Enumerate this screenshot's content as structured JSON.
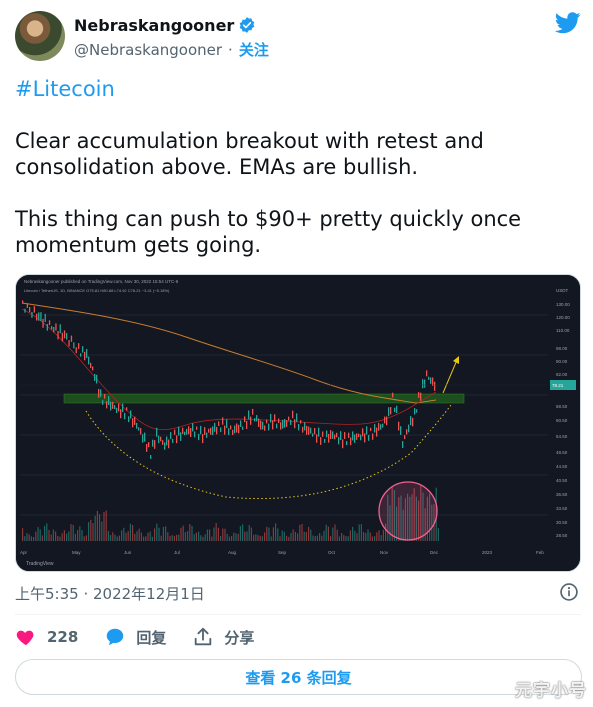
{
  "author": {
    "display_name": "Nebraskangooner",
    "handle": "@Nebraskangooner",
    "separator": "·",
    "follow_label": "关注",
    "verified": true
  },
  "tweet": {
    "hashtag": "#Litecoin",
    "paragraph1": "Clear accumulation breakout with retest and consolidation above. EMAs are bullish.",
    "paragraph2": "This thing can push to $90+ pretty quickly once momentum gets going."
  },
  "chart_image": {
    "header_line": "Nebraskangooner published on TradingView.com, Nov 30, 2022 15:54 UTC-6",
    "symbol_line": "Litecoin / TetherUS, 1D, BINANCE  O75.81 H80.88 L74.92 C78.21 −3.41 (−5.18%)",
    "currency": "USDT",
    "price_labels": [
      "130.00",
      "120.00",
      "110.00",
      "98.00",
      "90.00",
      "82.00",
      "78.21",
      "68.50",
      "60.50",
      "54.50",
      "48.50",
      "44.50",
      "40.50",
      "36.50",
      "33.50",
      "30.50",
      "28.50"
    ],
    "month_labels": [
      "Apr",
      "May",
      "Jun",
      "Jul",
      "Aug",
      "Sep",
      "Oct",
      "Nov",
      "Dec",
      "2023",
      "Feb"
    ],
    "footer_logo": "TradingView",
    "colors": {
      "background": "#131722",
      "candle_up": "#26a69a",
      "candle_down": "#ef5350",
      "ema_slow": "#c77d2e",
      "ema_fast": "#b22222",
      "zone": "#1e4d1e",
      "cup_dots": "#e6c619",
      "arrow": "#e6c619",
      "volume_circle": "#f06292"
    }
  },
  "meta": {
    "timestamp": "上午5:35 · 2022年12月1日"
  },
  "actions": {
    "like_count": "228",
    "reply_label": "回复",
    "share_label": "分享"
  },
  "footer": {
    "more_replies": "查看 26 条回复"
  },
  "watermark": "元宇小号"
}
